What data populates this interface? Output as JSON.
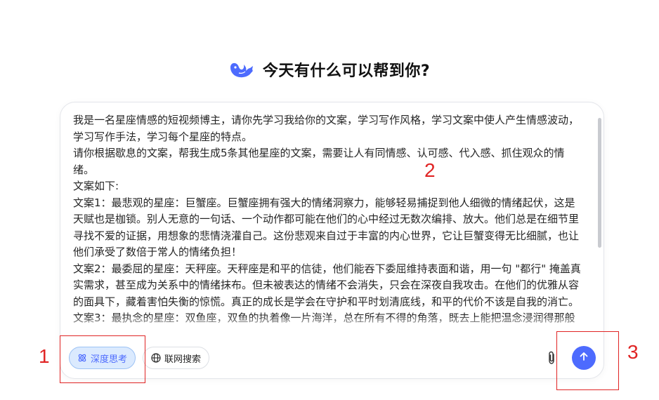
{
  "header": {
    "title": "今天有什么可以帮到你?"
  },
  "input": {
    "text": "我是一名星座情感的短视频博主，请你先学习我给你的文案，学习写作风格，学习文案中使人产生情感波动，学习写作手法，学习每个星座的特点。\n请你根据歇息的文案，帮我生成5条其他星座的文案，需要让人有同情感、认可感、代入感、抓住观众的情绪。\n文案如下:\n文案1：最悲观的星座：巨蟹座。巨蟹座拥有强大的情绪洞察力，能够轻易捕捉到他人细微的情绪起伏，这是天赋也是枷锁。别人无意的一句话、一个动作都可能在他们的心中经过无数次编排、放大。他们总是在细节里寻找不爱的证据，用想象的悲情浇灌自己。这份悲观来自过于丰富的内心世界，它让巨蟹变得无比细腻，也让他们承受了数倍于常人的情绪负担！\n文案2：最委屈的星座：天秤座。天秤座是和平的信徒，他们能吞下委屈维持表面和谐，用一句 \"都行\" 掩盖真实需求，甚至成为关系中的情绪抹布。但未被表达的情绪不会消失，只会在深夜自我攻击。在他们的优雅从容的面具下，藏着害怕失衡的惊慌。真正的成长是学会在守护和平时划清底线，和平的代价不该是自我的消亡。\n文案3：最执念的星座：双鱼座，双鱼的执着像一片海洋，总在所有不得的角落，既去上能把温念浸润得那般"
  },
  "toolbar": {
    "deep_think_label": "深度思考",
    "web_search_label": "联网搜索"
  },
  "icons": {
    "logo": "whale-logo-icon",
    "deep_think": "atom-icon",
    "web_search": "globe-icon",
    "attach": "paperclip-icon",
    "send": "arrow-up-icon"
  },
  "annotations": {
    "one": "1",
    "two": "2",
    "three": "3"
  },
  "colors": {
    "accent": "#4d6bfe",
    "annotation": "#e02424"
  }
}
